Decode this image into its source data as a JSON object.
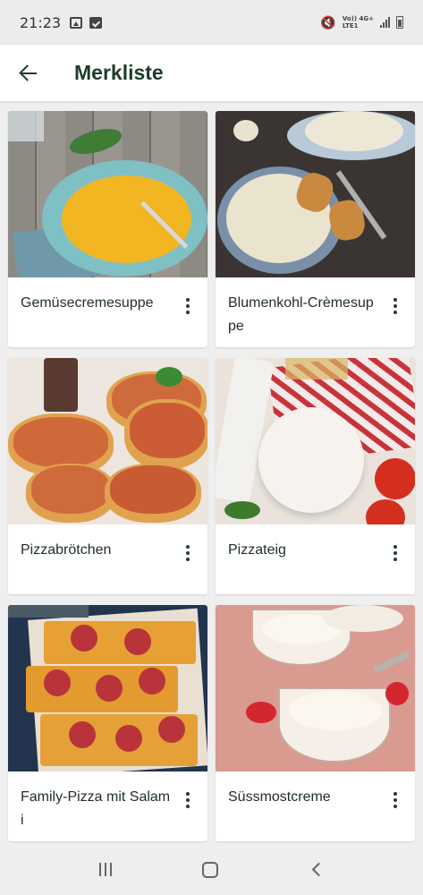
{
  "status": {
    "time": "21:23",
    "network_top": "Vo))  4G+",
    "network_bottom": "LTE1"
  },
  "header": {
    "title": "Merkliste"
  },
  "recipes": [
    {
      "title": "Gemüsecremesuppe"
    },
    {
      "title": "Blumenkohl-Crèmesuppe"
    },
    {
      "title": "Pizzabrötchen"
    },
    {
      "title": "Pizzateig"
    },
    {
      "title": "Family-Pizza mit Salami"
    },
    {
      "title": "Süssmostcreme"
    }
  ],
  "colors": {
    "primary_text": "#1d3d2c",
    "card_background": "#ffffff",
    "page_background": "#efefef"
  },
  "icons": {
    "back": "arrow-left-icon",
    "more": "more-vertical-icon"
  }
}
